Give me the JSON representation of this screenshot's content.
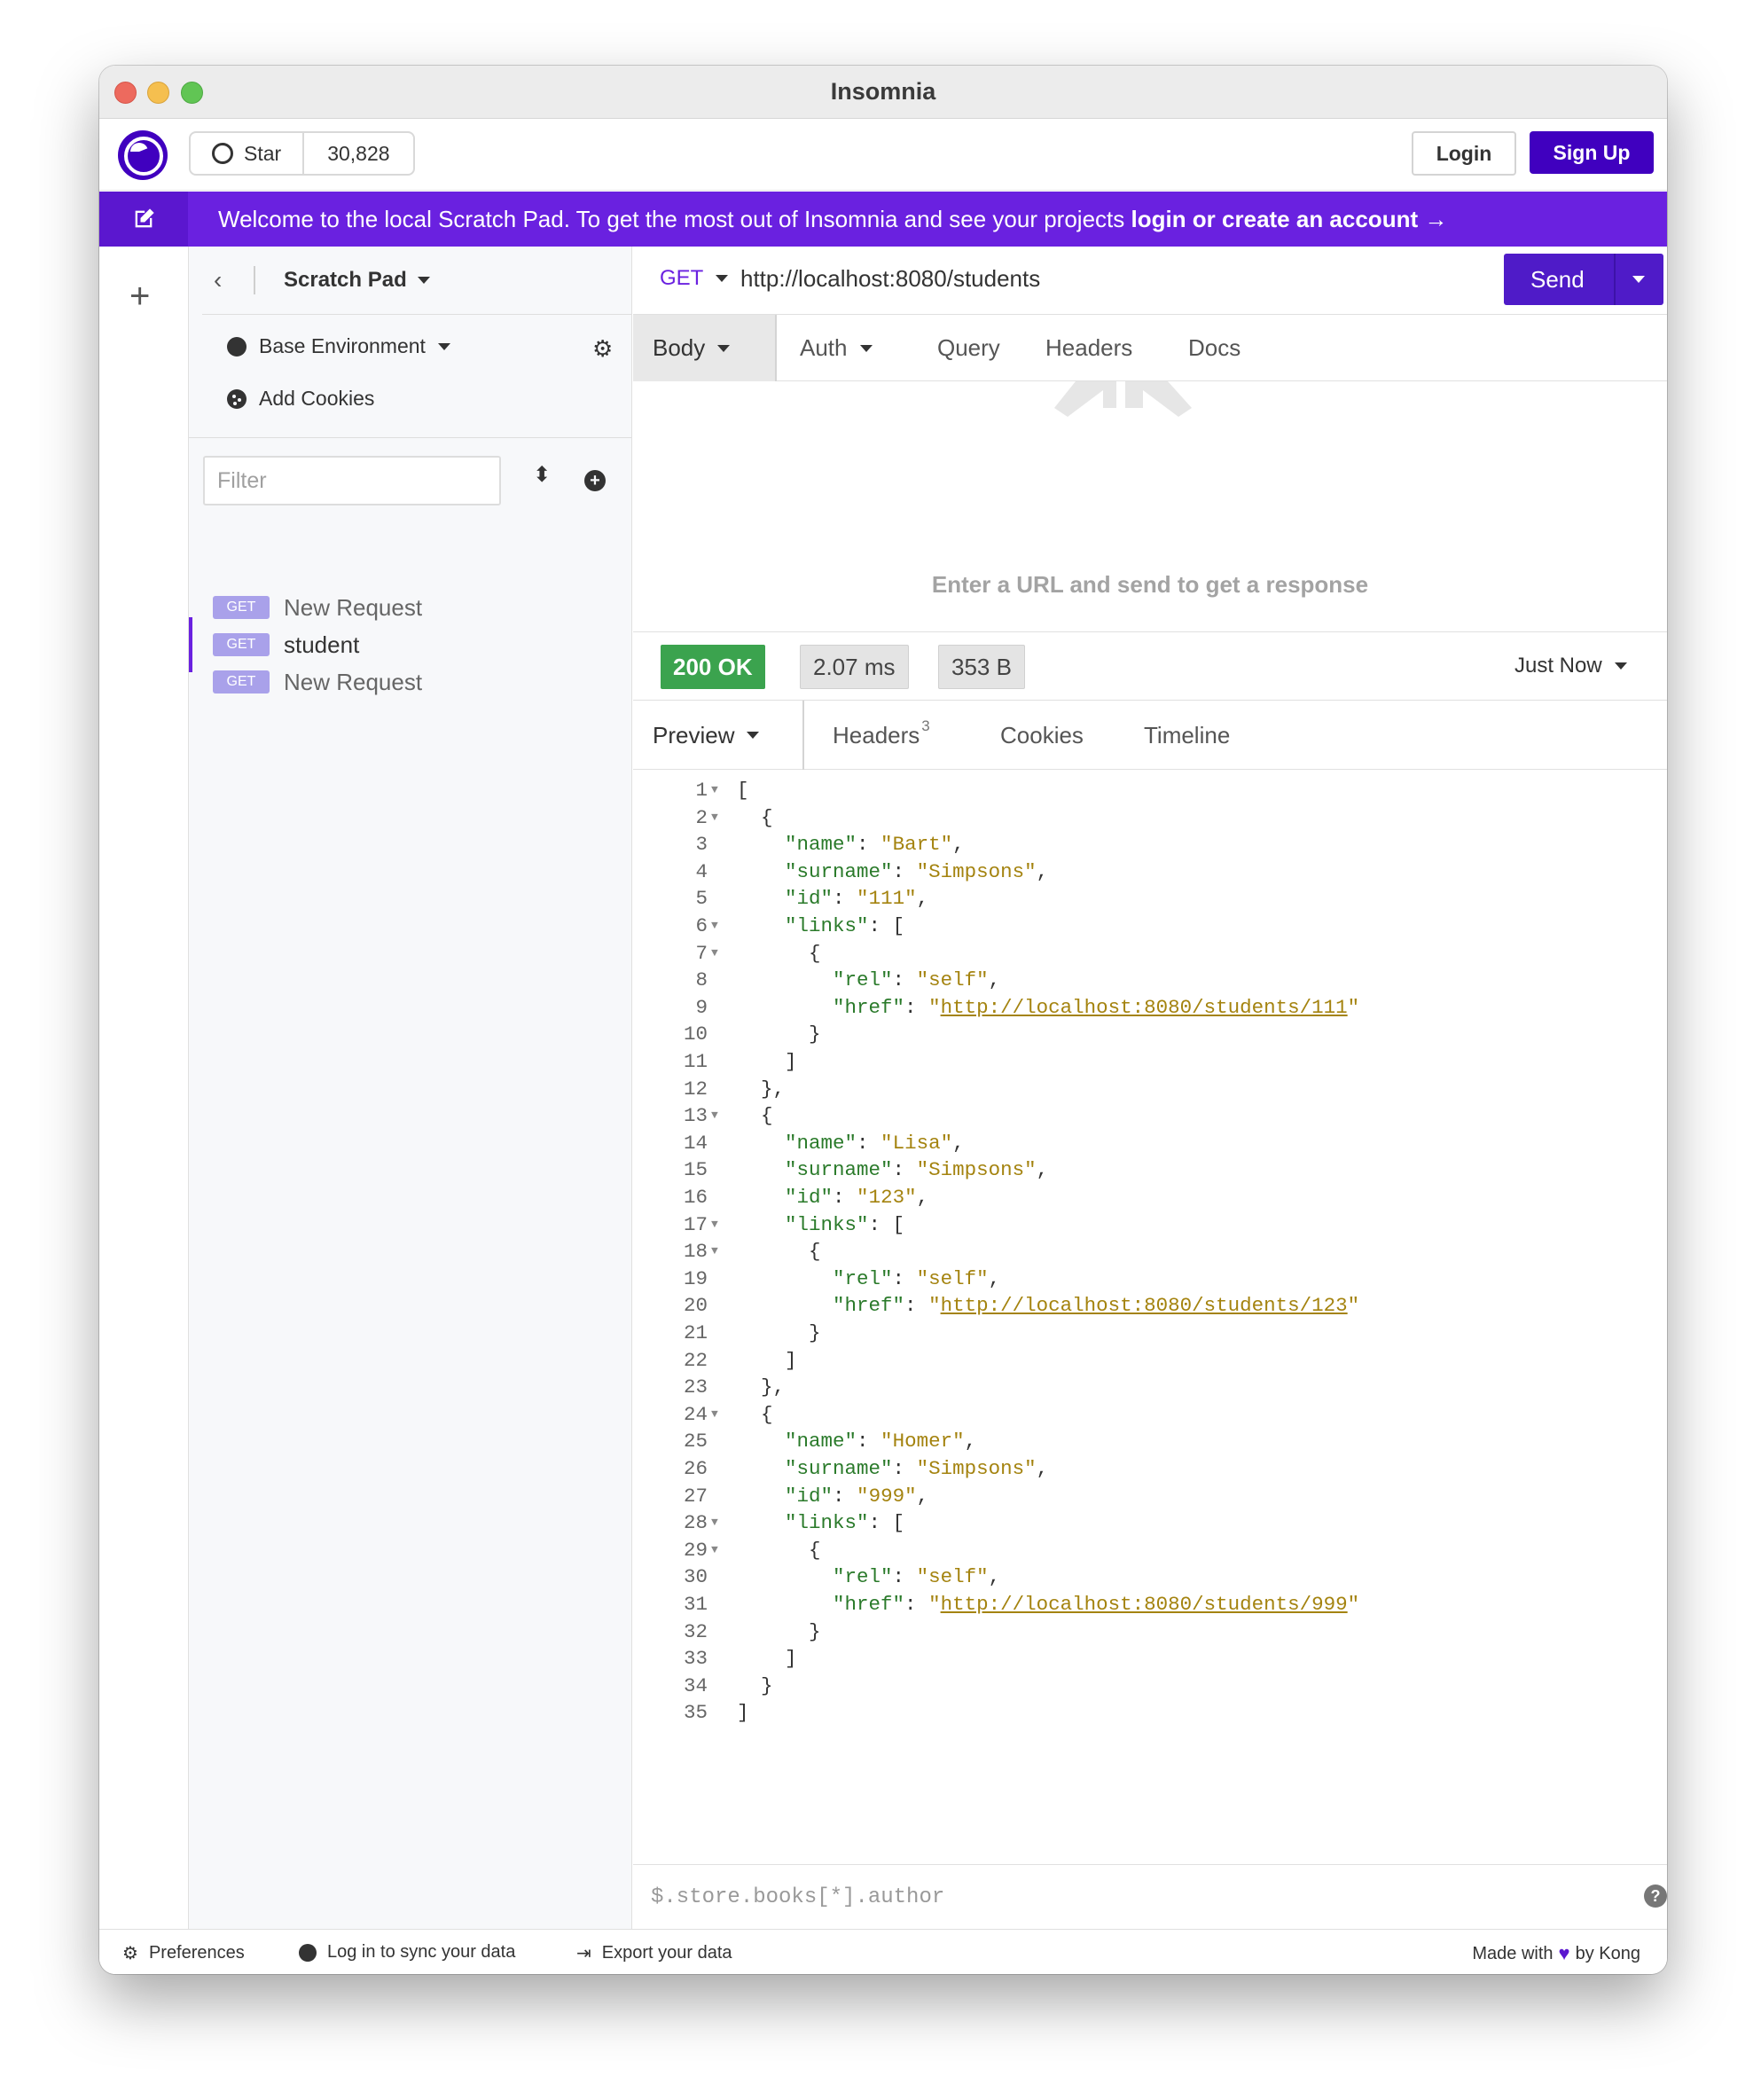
{
  "window": {
    "title": "Insomnia"
  },
  "topbar": {
    "star_label": "Star",
    "star_count": "30,828",
    "login_label": "Login",
    "signup_label": "Sign Up"
  },
  "banner": {
    "text": "Welcome to the local Scratch Pad. To get the most out of Insomnia and see your projects ",
    "link": "login or create an account →"
  },
  "sidebar": {
    "project": "Scratch Pad",
    "environment": "Base Environment",
    "cookies": "Add Cookies",
    "filter_placeholder": "Filter",
    "requests": [
      {
        "method": "GET",
        "name": "New Request",
        "active": false
      },
      {
        "method": "GET",
        "name": "student",
        "active": true
      },
      {
        "method": "GET",
        "name": "New Request",
        "active": false
      }
    ]
  },
  "request": {
    "method": "GET",
    "url": "http://localhost:8080/students",
    "send_label": "Send",
    "tabs": [
      "Body",
      "Auth",
      "Query",
      "Headers",
      "Docs"
    ],
    "hint": "Enter a URL and send to get a response"
  },
  "response": {
    "status": "200 OK",
    "time": "2.07 ms",
    "size": "353 B",
    "when": "Just Now",
    "tabs": {
      "preview": "Preview",
      "headers": "Headers",
      "headers_count": "3",
      "cookies": "Cookies",
      "timeline": "Timeline"
    },
    "students": [
      {
        "name": "Bart",
        "surname": "Simpsons",
        "id": "111",
        "href": "http://localhost:8080/students/111"
      },
      {
        "name": "Lisa",
        "surname": "Simpsons",
        "id": "123",
        "href": "http://localhost:8080/students/123"
      },
      {
        "name": "Homer",
        "surname": "Simpsons",
        "id": "999",
        "href": "http://localhost:8080/students/999"
      }
    ],
    "filter_placeholder": "$.store.books[*].author"
  },
  "footer": {
    "preferences": "Preferences",
    "sync": "Log in to sync your data",
    "export": "Export your data",
    "made_with": "Made with",
    "by": "by Kong"
  },
  "colors": {
    "brand": "#4000bf",
    "banner": "#6a21e0",
    "ok": "#3ba34e",
    "json_key": "#2a7a2a",
    "json_string": "#a4830f"
  }
}
